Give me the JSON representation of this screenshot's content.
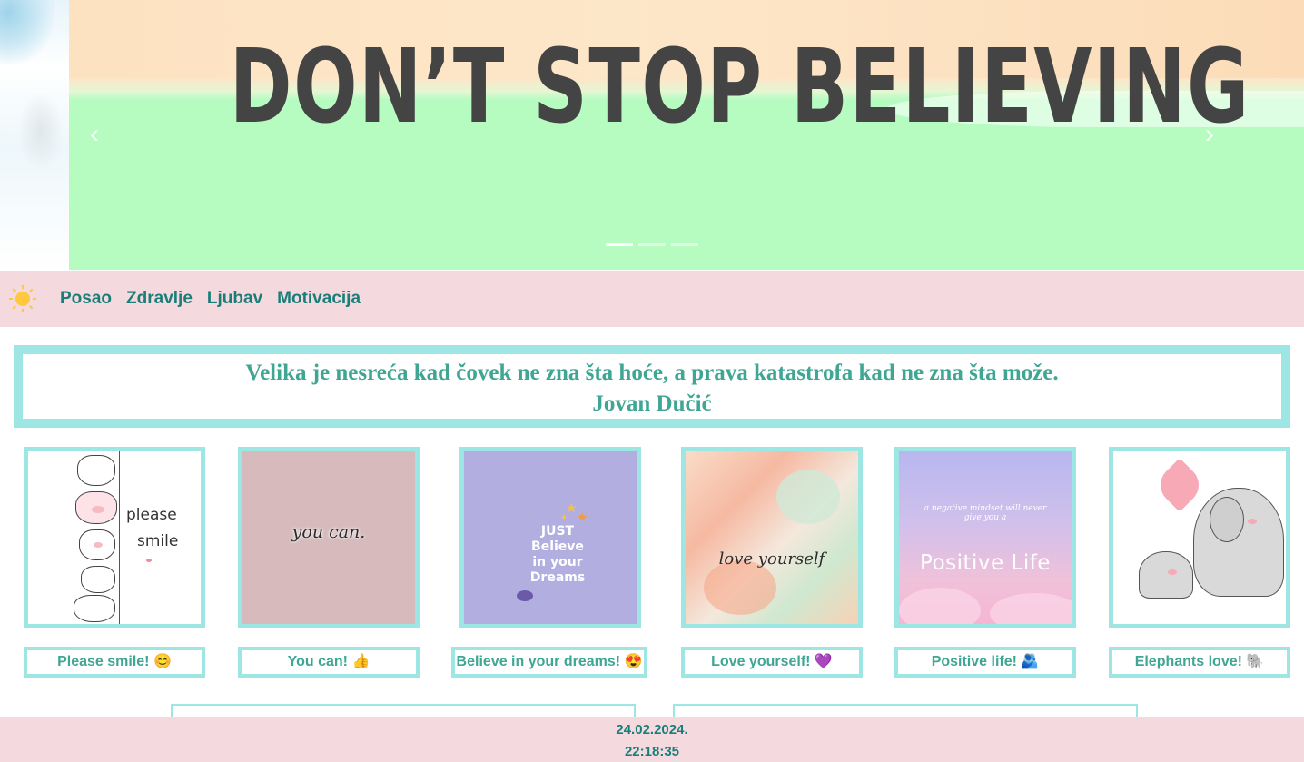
{
  "hero": {
    "slide_text": "DON’T STOP BELIEVING",
    "prev_icon": "‹",
    "next_icon": "›",
    "indicator_count": 3,
    "active_indicator": 0
  },
  "nav": {
    "icon": "sun-icon",
    "links": [
      {
        "label": "Posao"
      },
      {
        "label": "Zdravlje"
      },
      {
        "label": "Ljubav"
      },
      {
        "label": "Motivacija"
      }
    ]
  },
  "quote": {
    "text": "Velika je nesreća kad čovek ne zna šta hoće, a prava katastrofa kad ne zna šta može.",
    "author": "Jovan Dučić"
  },
  "gallery": {
    "images": [
      {
        "image_text_1": "please",
        "image_text_2": "smile",
        "caption": "Please smile! 😊"
      },
      {
        "image_text": "you can.",
        "caption": "You can! 👍"
      },
      {
        "image_text_1": "JUST",
        "image_text_2": "Believe",
        "image_text_3": "in your",
        "image_text_4": "Dreams",
        "caption": "Believe in your dreams! 😍"
      },
      {
        "image_text": "love yourself",
        "caption": "Love yourself! 💜"
      },
      {
        "image_text": "Positive Life",
        "image_subtext": "a negative mindset will never give you a",
        "caption": "Positive life! 🫂"
      },
      {
        "caption": "Elephants love! 🐘"
      }
    ]
  },
  "footer": {
    "date": "24.02.2024.",
    "time": "22:18:35"
  },
  "colors": {
    "accent_teal": "#1a7e78",
    "quote_text": "#3fa694",
    "border_cyan": "#9ee6e3",
    "pink_bar": "#f4d9de"
  }
}
